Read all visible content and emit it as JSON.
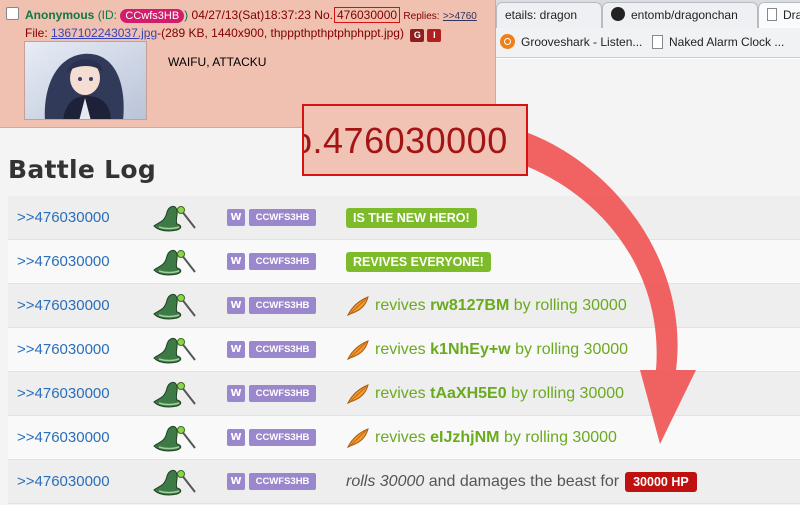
{
  "browser": {
    "tabs": [
      {
        "label": "etails: dragon"
      },
      {
        "label": "entomb/dragonchan"
      },
      {
        "label": "Dra"
      }
    ],
    "bookmarks": [
      {
        "label": "Grooveshark - Listen..."
      },
      {
        "label": "Naked Alarm Clock ..."
      }
    ]
  },
  "post": {
    "name": "Anonymous",
    "id_label_prefix": "(ID:",
    "id": "CCwfs3HB",
    "id_label_suffix": ")",
    "datetime": "04/27/13(Sat)18:37:23",
    "no_label": "No.",
    "number": "476030000",
    "replies_label": "Replies:",
    "replies_link": ">>4760",
    "file_label": "File:",
    "file_name": "1367102243037.jpg",
    "file_info": "-(289 KB, 1440x900, thpppthpthptphphppt.jpg)",
    "btn_g": "G",
    "btn_i": "I",
    "comment": "WAIFU, ATTACKU"
  },
  "zoom": {
    "text": "o.476030000"
  },
  "battle_log": {
    "title": "Battle Log",
    "rows": [
      {
        "link": ">>476030000",
        "class_badge": "W",
        "user_id": "CCWFS3HB",
        "kind": "pill",
        "pill": "IS THE NEW HERO!"
      },
      {
        "link": ">>476030000",
        "class_badge": "W",
        "user_id": "CCWFS3HB",
        "kind": "pill",
        "pill": "REVIVES EVERYONE!"
      },
      {
        "link": ">>476030000",
        "class_badge": "W",
        "user_id": "CCWFS3HB",
        "kind": "revive",
        "verb": "revives",
        "target": "rw8127BM",
        "suffix": "by rolling 30000"
      },
      {
        "link": ">>476030000",
        "class_badge": "W",
        "user_id": "CCWFS3HB",
        "kind": "revive",
        "verb": "revives",
        "target": "k1NhEy+w",
        "suffix": "by rolling 30000"
      },
      {
        "link": ">>476030000",
        "class_badge": "W",
        "user_id": "CCWFS3HB",
        "kind": "revive",
        "verb": "revives",
        "target": "tAaXH5E0",
        "suffix": "by rolling 30000"
      },
      {
        "link": ">>476030000",
        "class_badge": "W",
        "user_id": "CCWFS3HB",
        "kind": "revive",
        "verb": "revives",
        "target": "eIJzhjNM",
        "suffix": "by rolling 30000"
      },
      {
        "link": ">>476030000",
        "class_badge": "W",
        "user_id": "CCWFS3HB",
        "kind": "damage",
        "roll": "rolls 30000",
        "text": "and damages the beast for",
        "damage": "30000 HP"
      }
    ]
  },
  "colors": {
    "post_bg": "#f0c0b0",
    "highlight_red": "#d81212",
    "arrow": "#f05555",
    "link_blue": "#2a6ebb",
    "badge_purple": "#9b87cc",
    "green": "#7dbb2a",
    "damage_red": "#c01111"
  },
  "icons": {
    "class_icons": [
      "witch-hat-icon",
      "magic-wand-icon"
    ],
    "revive_icon": "phoenix-feather-icon",
    "bookmark_icons": [
      "grooveshark-icon",
      "page-icon"
    ],
    "tab_icons": [
      "github-icon",
      "page-icon"
    ]
  }
}
